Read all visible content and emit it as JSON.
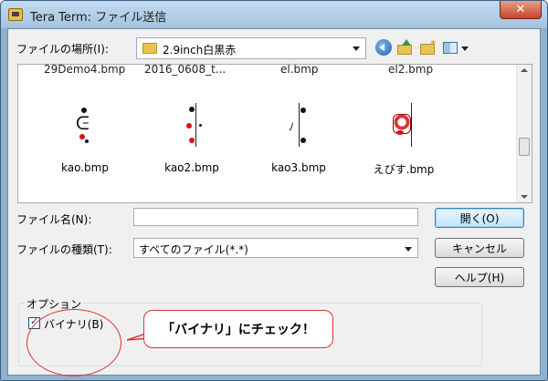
{
  "window": {
    "title": "Tera Term: ファイル送信",
    "close_glyph": "✕"
  },
  "location": {
    "label": "ファイルの場所(I):",
    "value": "2.9inch白黒赤"
  },
  "toolbar": {
    "icons": [
      "back-icon",
      "up-folder-icon",
      "new-folder-icon",
      "view-menu-icon"
    ]
  },
  "file_list": {
    "cut_off_row": [
      "29Demo4.bmp",
      "2016_0608_t...",
      "el.bmp",
      "el2.bmp"
    ],
    "files": [
      "kao.bmp",
      "kao2.bmp",
      "kao3.bmp",
      "えびす.bmp"
    ]
  },
  "filename": {
    "label": "ファイル名(N):",
    "value": ""
  },
  "filetype": {
    "label": "ファイルの種類(T):",
    "value": "すべてのファイル(*.*)"
  },
  "buttons": {
    "open": "開く(O)",
    "cancel": "キャンセル",
    "help": "ヘルプ(H)"
  },
  "options": {
    "legend": "オプション",
    "binary_label": "バイナリ(B)",
    "binary_checked": true,
    "check_glyph": "✓"
  },
  "annotation": {
    "callout_text": "「バイナリ」にチェック！",
    "color": "#dd3333"
  }
}
